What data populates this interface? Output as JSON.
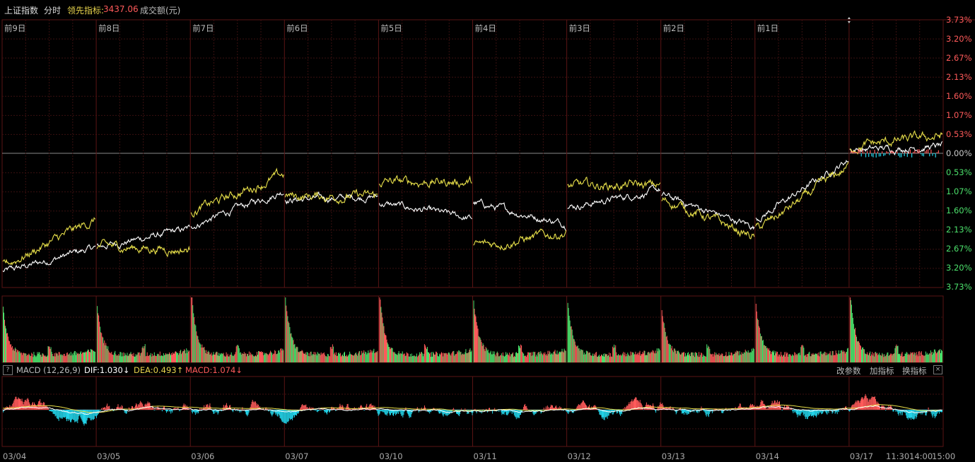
{
  "header": {
    "index_name": "上证指数",
    "mode": "分时",
    "lead_label": "领先指标:",
    "lead_value": "3437.06",
    "volume_label": "成交额(元)"
  },
  "colors": {
    "up": "#ff5a5a",
    "down": "#4ce06b",
    "price_line": "#ffffff",
    "lead_line": "#e8e04a",
    "macd_neg": "#22d3e8",
    "grid": "#3a1010"
  },
  "icons": {
    "help": "?",
    "close": "×",
    "zero_marker": "diamond-arrow-icon"
  },
  "macd_panel": {
    "name": "MACD (12,26,9)",
    "dif": "DIF:1.030↓",
    "dea": "DEA:0.493↑",
    "macd": "MACD:1.074↓",
    "buttons": [
      "改参数",
      "加指标",
      "换指标"
    ]
  },
  "chart_data": [
    {
      "type": "line",
      "title": "上证指数 分时",
      "day_labels": [
        "前9日",
        "前8日",
        "前7日",
        "前6日",
        "前5日",
        "前4日",
        "前3日",
        "前2日",
        "前1日"
      ],
      "dates": [
        "03/04",
        "03/05",
        "03/06",
        "03/07",
        "03/10",
        "03/11",
        "03/12",
        "03/13",
        "03/14",
        "03/17"
      ],
      "last_day_times": [
        "11:30",
        "14:00",
        "15:00"
      ],
      "y_ticks_upper": [
        "3.73%",
        "3.20%",
        "2.67%",
        "2.13%",
        "1.60%",
        "1.07%",
        "0.53%"
      ],
      "y_tick_zero": "0.00%",
      "y_ticks_lower": [
        "0.53%",
        "1.07%",
        "1.60%",
        "2.13%",
        "2.67%",
        "3.20%",
        "3.73%"
      ],
      "ylim_pct": [
        -3.73,
        3.73
      ],
      "series": [
        {
          "name": "上证指数",
          "color": "white",
          "day_pct": [
            [
              -3.3,
              -2.6
            ],
            [
              -2.6,
              -2.1
            ],
            [
              -2.0,
              -1.0
            ],
            [
              -1.3,
              -1.2
            ],
            [
              -1.4,
              -1.85
            ],
            [
              -1.4,
              -2.0
            ],
            [
              -1.5,
              -1.0
            ],
            [
              -1.2,
              -2.1
            ],
            [
              -1.8,
              -0.1
            ],
            [
              0.1,
              0.2
            ]
          ]
        },
        {
          "name": "领先指标",
          "color": "yellow",
          "day_pct": [
            [
              -3.1,
              -1.8
            ],
            [
              -2.6,
              -2.7
            ],
            [
              -1.6,
              -0.55
            ],
            [
              -1.2,
              -1.2
            ],
            [
              -0.8,
              -0.8
            ],
            [
              -2.6,
              -2.2
            ],
            [
              -0.9,
              -0.9
            ],
            [
              -1.3,
              -2.4
            ],
            [
              -2.1,
              -0.3
            ],
            [
              0.2,
              0.5
            ]
          ]
        }
      ]
    },
    {
      "type": "bar",
      "title": "成交额(元)",
      "categories": [
        "03/04",
        "03/05",
        "03/06",
        "03/07",
        "03/10",
        "03/11",
        "03/12",
        "03/13",
        "03/14",
        "03/17"
      ],
      "opening_spike_rel": [
        0.7,
        0.75,
        0.98,
        0.9,
        0.95,
        0.85,
        0.82,
        0.68,
        0.78,
        0.98
      ]
    },
    {
      "type": "bar",
      "title": "MACD (12,26,9)",
      "DIF": 1.03,
      "DEA": 0.493,
      "MACD": 1.074
    }
  ]
}
